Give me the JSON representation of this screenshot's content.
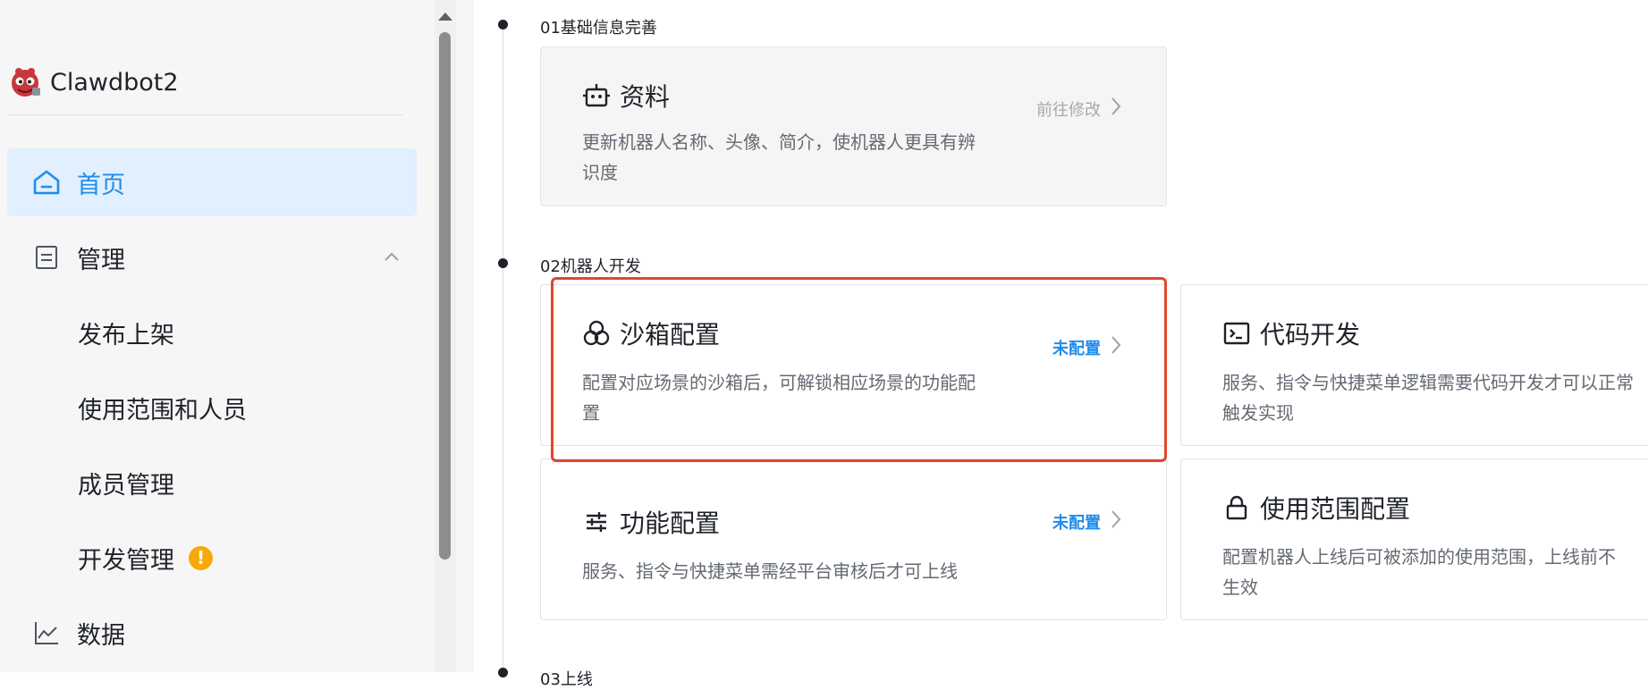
{
  "app": {
    "name": "Clawdbot2",
    "logo_icon": "bot-avatar-icon"
  },
  "colors": {
    "accent": "#1f8cec",
    "active_bg": "#e1effe",
    "warning": "#f7a90b",
    "highlight": "#e0462f"
  },
  "sidebar": {
    "items": [
      {
        "label": "首页",
        "icon": "home-icon",
        "active": true
      },
      {
        "label": "管理",
        "icon": "management-icon",
        "expanded": true
      },
      {
        "label": "发布上架"
      },
      {
        "label": "使用范围和人员"
      },
      {
        "label": "成员管理"
      },
      {
        "label": "开发管理",
        "badge": "!"
      },
      {
        "label": "数据",
        "icon": "chart-icon"
      }
    ]
  },
  "sections": [
    {
      "title": "01基础信息完善",
      "cards": [
        {
          "title": "资料",
          "icon": "robot-icon",
          "desc_line1": "更新机器人名称、头像、简介，使机器人更具有辨",
          "desc_line2": "识度",
          "action": "前往修改",
          "disabled": true
        }
      ]
    },
    {
      "title": "02机器人开发",
      "cards": [
        {
          "title": "沙箱配置",
          "icon": "sandbox-icon",
          "desc_line1": "配置对应场景的沙箱后，可解锁相应场景的功能配",
          "desc_line2": "置",
          "action": "未配置",
          "highlighted": true
        },
        {
          "title": "代码开发",
          "icon": "terminal-icon",
          "desc_line1": "服务、指令与快捷菜单逻辑需要代码开发才可以正常",
          "desc_line2": "触发实现"
        },
        {
          "title": "功能配置",
          "icon": "sliders-icon",
          "desc_line1": "服务、指令与快捷菜单需经平台审核后才可上线",
          "action": "未配置"
        },
        {
          "title": "使用范围配置",
          "icon": "lock-icon",
          "desc_line1": "配置机器人上线后可被添加的使用范围，上线前不",
          "desc_line2": "生效"
        }
      ]
    },
    {
      "title": "03上线"
    }
  ]
}
